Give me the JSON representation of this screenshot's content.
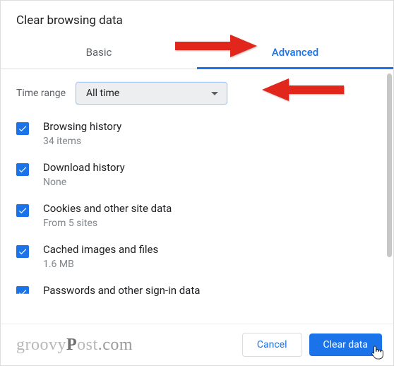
{
  "title": "Clear browsing data",
  "tabs": {
    "basic": "Basic",
    "advanced": "Advanced"
  },
  "timerange": {
    "label": "Time range",
    "value": "All time"
  },
  "items": [
    {
      "label": "Browsing history",
      "sub": "34 items"
    },
    {
      "label": "Download history",
      "sub": "None"
    },
    {
      "label": "Cookies and other site data",
      "sub": "From 5 sites"
    },
    {
      "label": "Cached images and files",
      "sub": "1.6 MB"
    },
    {
      "label": "Passwords and other sign-in data",
      "sub": ""
    }
  ],
  "buttons": {
    "cancel": "Cancel",
    "clear": "Clear data"
  },
  "watermark": {
    "a": "groovy",
    "b": "P",
    "c": "ost",
    "d": ".com"
  }
}
